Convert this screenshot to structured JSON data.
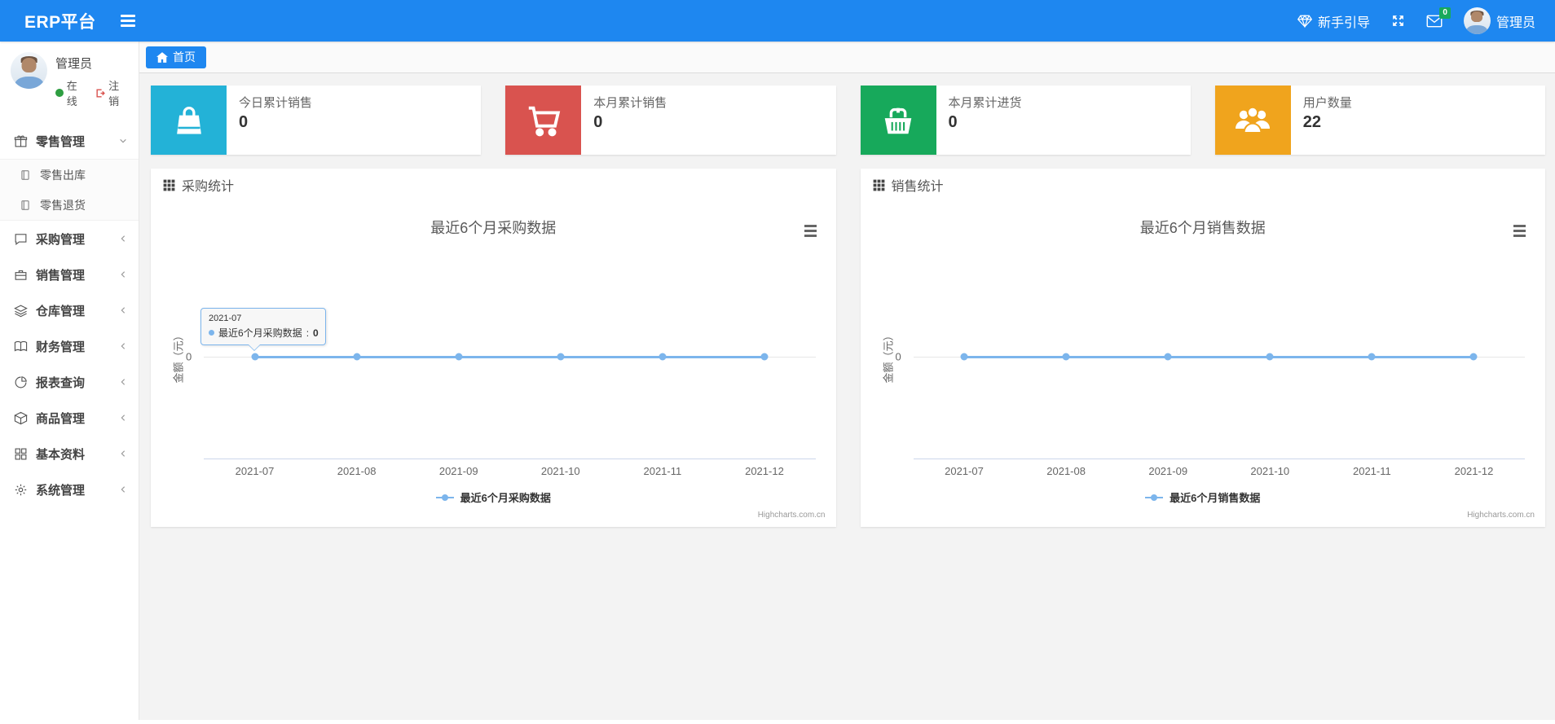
{
  "navbar": {
    "brand": "ERP平台",
    "guide_label": "新手引导",
    "mail_badge": "0",
    "username": "管理员",
    "bar_color": "#1e87f0"
  },
  "sidebar": {
    "profile": {
      "name": "管理员",
      "online_label": "在线",
      "logout_label": "注销",
      "online_color": "#2e9e41",
      "logout_color": "#d9534f"
    },
    "menu": [
      {
        "label": "零售管理",
        "icon": "gift-icon",
        "state": "expanded",
        "children": [
          {
            "label": "零售出库",
            "icon": "file-icon"
          },
          {
            "label": "零售退货",
            "icon": "file-icon"
          }
        ]
      },
      {
        "label": "采购管理",
        "icon": "comment-icon",
        "state": "collapsed"
      },
      {
        "label": "销售管理",
        "icon": "briefcase-icon",
        "state": "collapsed"
      },
      {
        "label": "仓库管理",
        "icon": "layers-icon",
        "state": "collapsed"
      },
      {
        "label": "财务管理",
        "icon": "book-icon",
        "state": "collapsed"
      },
      {
        "label": "报表查询",
        "icon": "pie-chart-icon",
        "state": "collapsed"
      },
      {
        "label": "商品管理",
        "icon": "cube-icon",
        "state": "collapsed"
      },
      {
        "label": "基本资料",
        "icon": "grid-icon",
        "state": "collapsed"
      },
      {
        "label": "系统管理",
        "icon": "gear-icon",
        "state": "collapsed"
      }
    ]
  },
  "tabs": {
    "home": "首页"
  },
  "cards": [
    {
      "title": "今日累计销售",
      "value": "0",
      "color": "#23b2d7",
      "icon": "shopping-bag-icon"
    },
    {
      "title": "本月累计销售",
      "value": "0",
      "color": "#d9534f",
      "icon": "shopping-cart-icon"
    },
    {
      "title": "本月累计进货",
      "value": "0",
      "color": "#17a95b",
      "icon": "basket-icon"
    },
    {
      "title": "用户数量",
      "value": "22",
      "color": "#f0a41d",
      "icon": "users-icon"
    }
  ],
  "panels": [
    {
      "title": "采购统计"
    },
    {
      "title": "销售统计"
    }
  ],
  "chart_data": [
    {
      "type": "line",
      "title": "最近6个月采购数据",
      "categories": [
        "2021-07",
        "2021-08",
        "2021-09",
        "2021-10",
        "2021-11",
        "2021-12"
      ],
      "series": [
        {
          "name": "最近6个月采购数据",
          "values": [
            0,
            0,
            0,
            0,
            0,
            0
          ]
        }
      ],
      "ylabel": "金额（元）",
      "ytick": "0",
      "ylim": [
        -1,
        1
      ],
      "grid": true,
      "legend_position": "bottom",
      "line_color": "#7cb5ec",
      "credit": "Highcharts.com.cn",
      "tooltip": {
        "header": "2021-07",
        "series_name": "最近6个月采购数据",
        "separator": ":",
        "value": "0"
      }
    },
    {
      "type": "line",
      "title": "最近6个月销售数据",
      "categories": [
        "2021-07",
        "2021-08",
        "2021-09",
        "2021-10",
        "2021-11",
        "2021-12"
      ],
      "series": [
        {
          "name": "最近6个月销售数据",
          "values": [
            0,
            0,
            0,
            0,
            0,
            0
          ]
        }
      ],
      "ylabel": "金额（元）",
      "ytick": "0",
      "ylim": [
        -1,
        1
      ],
      "grid": true,
      "legend_position": "bottom",
      "line_color": "#7cb5ec",
      "credit": "Highcharts.com.cn"
    }
  ]
}
